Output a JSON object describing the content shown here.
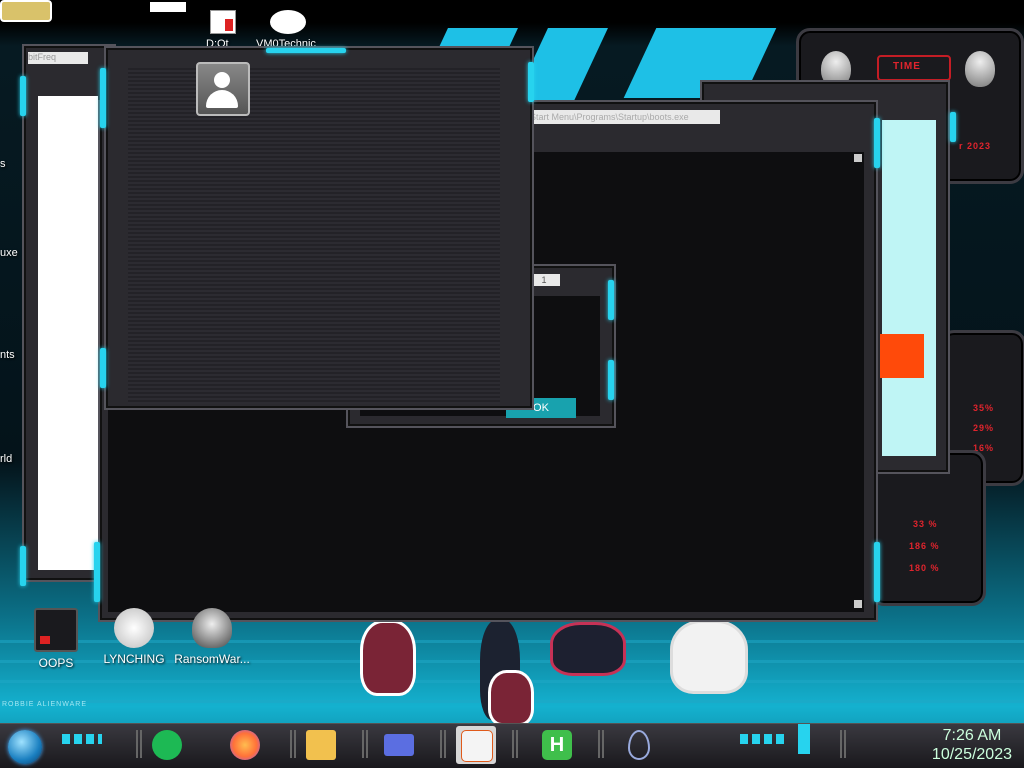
{
  "desktop": {
    "top_icons": [
      {
        "label": "D:Qt",
        "icon": "document-icon"
      },
      {
        "label": "VM0Technic",
        "icon": "cartoon-icon"
      }
    ],
    "left_partial_labels": [
      "s",
      "uxe",
      "nts",
      "rld"
    ],
    "icons": [
      {
        "label": "OOPS",
        "icon": "alienware-monitor-icon"
      },
      {
        "label": "LYNCHING",
        "icon": "ribbon-icon"
      },
      {
        "label": "RansomWar...",
        "icon": "skull-icon"
      }
    ],
    "social_text": "ROBBIE ALIENWARE"
  },
  "windows": {
    "back_left_title": "bitFreq",
    "main_path": "Start Menu\\Programs\\Startup\\boots.exe",
    "dialog": {
      "title_value": "1",
      "ok_label": "OK"
    }
  },
  "gadgets": {
    "time_label": "TIME",
    "cpu_text": "r 2023",
    "stats1": [
      "35%",
      "29%",
      "16%"
    ],
    "stats2": [
      "33 %",
      "186 %",
      "180 %"
    ]
  },
  "taskbar": {
    "apps": [
      {
        "name": "spotify-icon",
        "color": "#1db954"
      },
      {
        "name": "firefox-icon",
        "color": "#ff7139"
      },
      {
        "name": "file-explorer-icon",
        "color": "#f2c14e"
      },
      {
        "name": "card-app-icon",
        "color": "#5b6ee1"
      },
      {
        "name": "java-icon",
        "color": "#e8e8e8"
      },
      {
        "name": "h-app-icon",
        "color": "#3fbf4b"
      },
      {
        "name": "drop-icon",
        "color": "#9ad"
      }
    ],
    "time": "7:26 AM",
    "date": "10/25/2023"
  },
  "colors": {
    "accent": "#27d3ee",
    "alert": "#ff4a0a",
    "gadget_text": "#e0242d"
  }
}
